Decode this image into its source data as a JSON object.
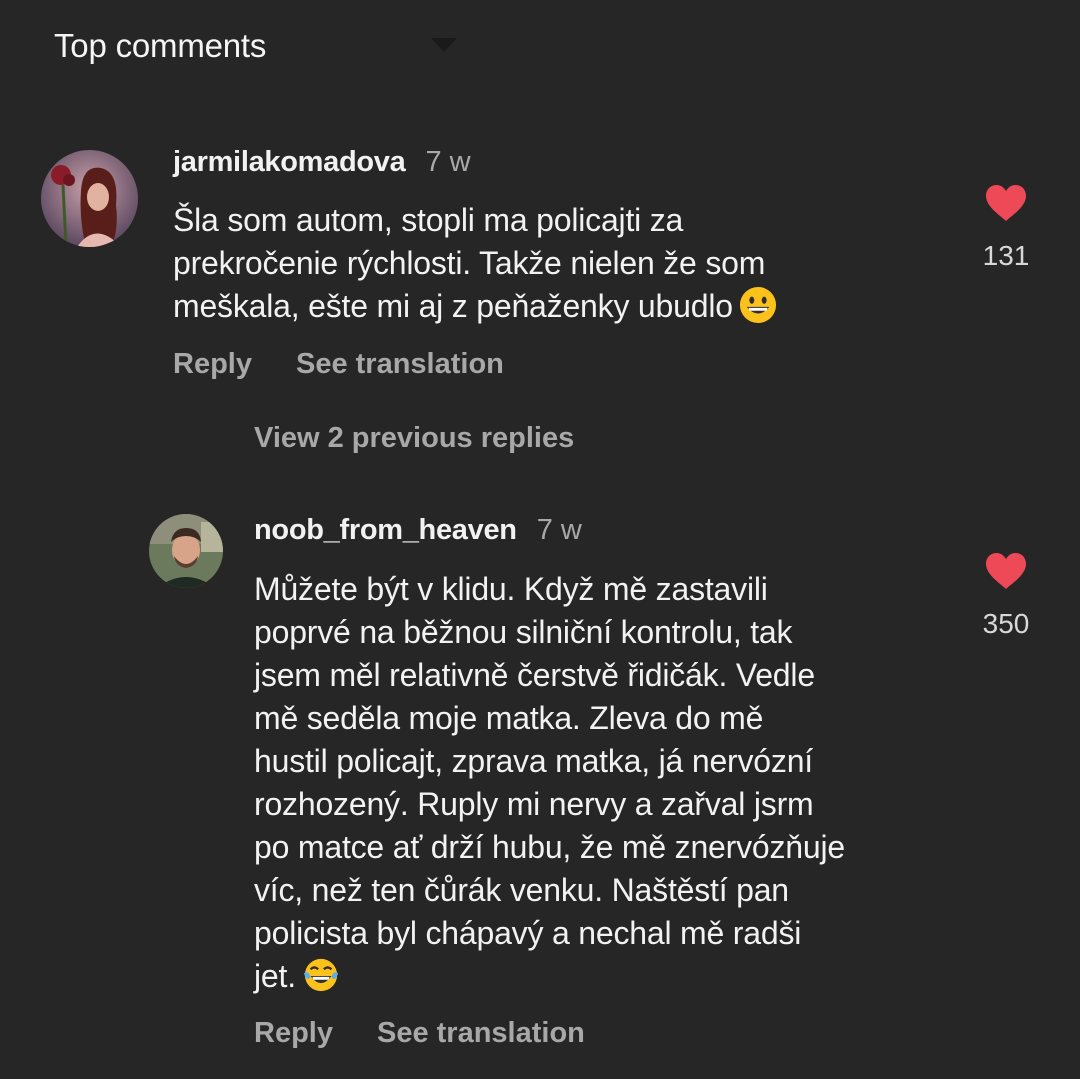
{
  "header": {
    "sort_label": "Top comments",
    "sort_icon": "caret-down-icon"
  },
  "comments": [
    {
      "avatar_icon": "user-avatar-woman-roses",
      "username": "jarmilakomadova",
      "time": "7 w",
      "lines": [
        "Šla som autom, stopli ma policajti za",
        "prekročenie rýchlosti. Takže nielen že som",
        "meškala, ešte mi aj z peňaženky ubudlo"
      ],
      "emoji": "grinning-face-emoji",
      "likes": "131",
      "reply_label": "Reply",
      "translate_label": "See translation"
    },
    {
      "avatar_icon": "user-avatar-man",
      "username": "noob_from_heaven",
      "time": "7 w",
      "lines": [
        "Můžete být v klidu. Když mě zastavili",
        "poprvé na běžnou silniční kontrolu, tak",
        "jsem měl relativně čerstvě řidičák. Vedle",
        "mě seděla moje matka. Zleva do mě",
        "hustil policajt, zprava matka, já nervózní",
        "rozhozený. Ruply mi nervy a zařval jsrm",
        "po matce ať drží hubu, že mě znervózňuje",
        "víc, než ten čůrák venku. Naštěstí pan",
        "policista byl chápavý a nechal mě radši",
        "jet."
      ],
      "emoji": "tears-of-joy-emoji",
      "likes": "350",
      "reply_label": "Reply",
      "translate_label": "See translation"
    }
  ],
  "thread": {
    "view_replies_label": "View 2 previous replies"
  },
  "colors": {
    "background": "#262626",
    "text_primary": "#f2f2f2",
    "text_secondary": "#a8a8a8",
    "heart": "#ed4956"
  }
}
